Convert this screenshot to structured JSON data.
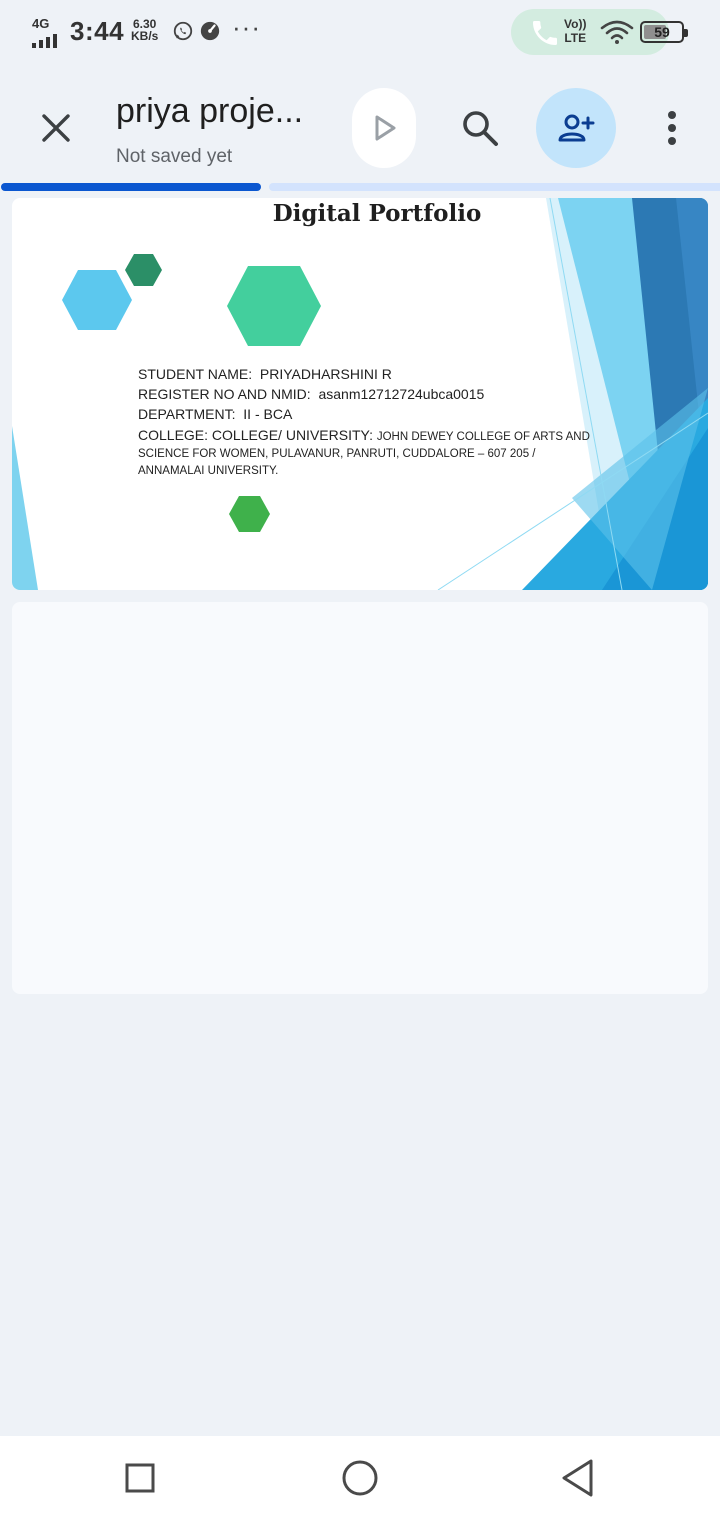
{
  "status_bar": {
    "network_type": "4G",
    "time": "3:44",
    "speed_value": "6.30",
    "speed_unit": "KB/s",
    "more_indicator": "···",
    "volte_top": "Vo))",
    "volte_bottom": "LTE",
    "battery": "59",
    "icons": [
      "signal-icon",
      "whatsapp-icon",
      "speedometer-icon",
      "phone-call-icon",
      "wifi-icon",
      "battery-icon"
    ]
  },
  "app_bar": {
    "title": "priya proje...",
    "save_status": "Not saved yet",
    "icons": [
      "close-icon",
      "present-play-icon",
      "search-icon",
      "add-person-icon",
      "more-vert-icon"
    ],
    "accent_color": "#0b57d0",
    "share_bg": "#c2e4fb"
  },
  "slides": [
    {
      "title": "Digital Portfolio",
      "student_label": "STUDENT NAME:",
      "student_value": "PRIYADHARSHINI R",
      "register_label": "REGISTER NO AND NMID:",
      "register_value": "asanm12712724ubca0015",
      "department_label": "DEPARTMENT:",
      "department_value": "II - BCA",
      "college_label": "COLLEGE: COLLEGE/ UNIVERSITY:",
      "college_value_line1": "JOHN DEWEY COLLEGE OF ARTS AND",
      "college_value_line2": "SCIENCE FOR WOMEN, PULAVANUR, PANRUTI, CUDDALORE – 607 205 /",
      "college_value_line3": "ANNAMALAI UNIVERSITY."
    },
    {
      "title": ""
    }
  ],
  "nav_bar": {
    "icons": [
      "recent-apps-icon",
      "home-icon",
      "back-icon"
    ]
  }
}
